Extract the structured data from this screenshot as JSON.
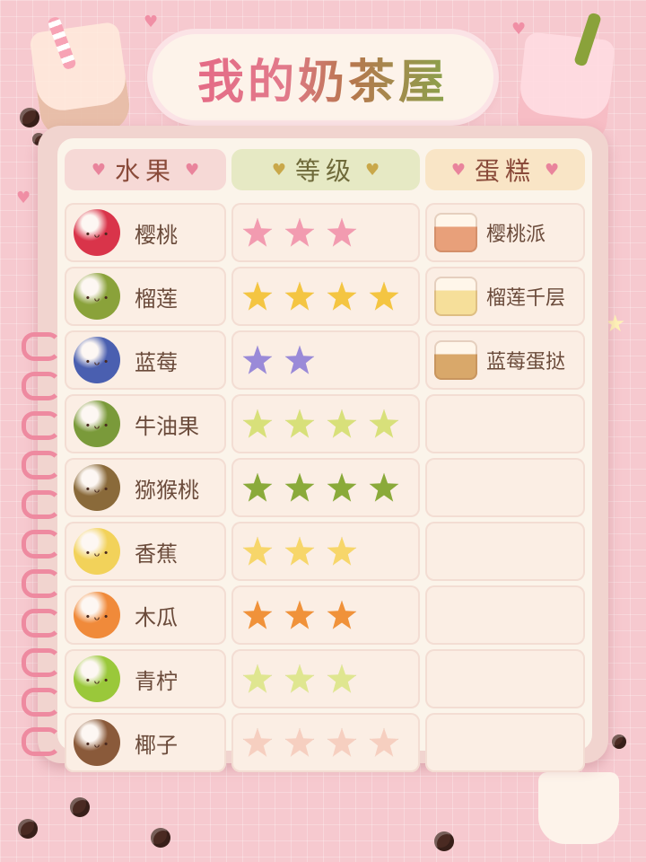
{
  "title": "我的奶茶屋",
  "columns": {
    "fruit": "水果",
    "level": "等级",
    "cake": "蛋糕"
  },
  "rows": [
    {
      "fruit": "樱桃",
      "fruit_icon": "cherry-icon",
      "fruit_color": "#d9344a",
      "stars": 3,
      "star_color": "#f29bb0",
      "cake": "樱桃派",
      "cake_icon": "cherry-pie-icon",
      "cake_color": "#e8a07a"
    },
    {
      "fruit": "榴莲",
      "fruit_icon": "durian-icon",
      "fruit_color": "#8aa23a",
      "stars": 4,
      "star_color": "#f4c542",
      "cake": "榴莲千层",
      "cake_icon": "durian-cake-icon",
      "cake_color": "#f6df9a"
    },
    {
      "fruit": "蓝莓",
      "fruit_icon": "blueberry-icon",
      "fruit_color": "#4a5fb0",
      "stars": 2,
      "star_color": "#9a8ad8",
      "cake": "蓝莓蛋挞",
      "cake_icon": "blueberry-tart-icon",
      "cake_color": "#d9a86a"
    },
    {
      "fruit": "牛油果",
      "fruit_icon": "avocado-icon",
      "fruit_color": "#7a9a3a",
      "stars": 4,
      "star_color": "#d8e07a",
      "cake": "",
      "cake_icon": "",
      "cake_color": ""
    },
    {
      "fruit": "猕猴桃",
      "fruit_icon": "kiwi-icon",
      "fruit_color": "#8a6a3a",
      "stars": 4,
      "star_color": "#8aaa3a",
      "cake": "",
      "cake_icon": "",
      "cake_color": ""
    },
    {
      "fruit": "香蕉",
      "fruit_icon": "banana-icon",
      "fruit_color": "#f2d25a",
      "stars": 3,
      "star_color": "#f7d66a",
      "cake": "",
      "cake_icon": "",
      "cake_color": ""
    },
    {
      "fruit": "木瓜",
      "fruit_icon": "papaya-icon",
      "fruit_color": "#f08a3a",
      "stars": 3,
      "star_color": "#f0923a",
      "cake": "",
      "cake_icon": "",
      "cake_color": ""
    },
    {
      "fruit": "青柠",
      "fruit_icon": "lime-icon",
      "fruit_color": "#9ac83a",
      "stars": 3,
      "star_color": "#dfe690",
      "cake": "",
      "cake_icon": "",
      "cake_color": ""
    },
    {
      "fruit": "椰子",
      "fruit_icon": "coconut-icon",
      "fruit_color": "#8a5a3a",
      "stars": 4,
      "star_color": "#f6cfc0",
      "cake": "",
      "cake_icon": "",
      "cake_color": ""
    }
  ],
  "colors": {
    "background": "#f6c9cf",
    "paper": "#fbf4ea",
    "accent": "#e9849c"
  }
}
